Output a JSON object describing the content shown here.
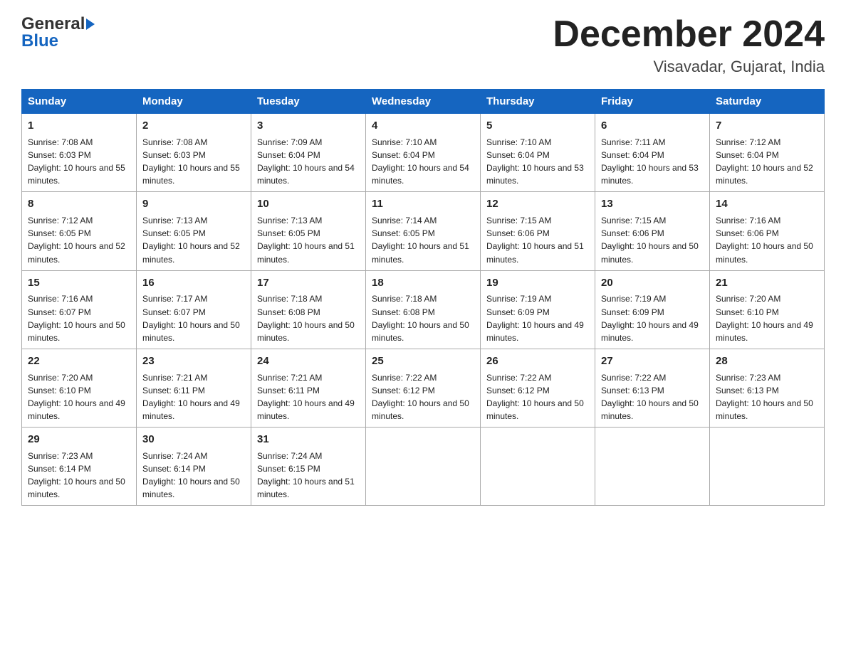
{
  "header": {
    "logo_general": "General",
    "logo_blue": "Blue",
    "month_title": "December 2024",
    "location": "Visavadar, Gujarat, India"
  },
  "days_of_week": [
    "Sunday",
    "Monday",
    "Tuesday",
    "Wednesday",
    "Thursday",
    "Friday",
    "Saturday"
  ],
  "weeks": [
    [
      {
        "day": "1",
        "sunrise": "7:08 AM",
        "sunset": "6:03 PM",
        "daylight": "10 hours and 55 minutes."
      },
      {
        "day": "2",
        "sunrise": "7:08 AM",
        "sunset": "6:03 PM",
        "daylight": "10 hours and 55 minutes."
      },
      {
        "day": "3",
        "sunrise": "7:09 AM",
        "sunset": "6:04 PM",
        "daylight": "10 hours and 54 minutes."
      },
      {
        "day": "4",
        "sunrise": "7:10 AM",
        "sunset": "6:04 PM",
        "daylight": "10 hours and 54 minutes."
      },
      {
        "day": "5",
        "sunrise": "7:10 AM",
        "sunset": "6:04 PM",
        "daylight": "10 hours and 53 minutes."
      },
      {
        "day": "6",
        "sunrise": "7:11 AM",
        "sunset": "6:04 PM",
        "daylight": "10 hours and 53 minutes."
      },
      {
        "day": "7",
        "sunrise": "7:12 AM",
        "sunset": "6:04 PM",
        "daylight": "10 hours and 52 minutes."
      }
    ],
    [
      {
        "day": "8",
        "sunrise": "7:12 AM",
        "sunset": "6:05 PM",
        "daylight": "10 hours and 52 minutes."
      },
      {
        "day": "9",
        "sunrise": "7:13 AM",
        "sunset": "6:05 PM",
        "daylight": "10 hours and 52 minutes."
      },
      {
        "day": "10",
        "sunrise": "7:13 AM",
        "sunset": "6:05 PM",
        "daylight": "10 hours and 51 minutes."
      },
      {
        "day": "11",
        "sunrise": "7:14 AM",
        "sunset": "6:05 PM",
        "daylight": "10 hours and 51 minutes."
      },
      {
        "day": "12",
        "sunrise": "7:15 AM",
        "sunset": "6:06 PM",
        "daylight": "10 hours and 51 minutes."
      },
      {
        "day": "13",
        "sunrise": "7:15 AM",
        "sunset": "6:06 PM",
        "daylight": "10 hours and 50 minutes."
      },
      {
        "day": "14",
        "sunrise": "7:16 AM",
        "sunset": "6:06 PM",
        "daylight": "10 hours and 50 minutes."
      }
    ],
    [
      {
        "day": "15",
        "sunrise": "7:16 AM",
        "sunset": "6:07 PM",
        "daylight": "10 hours and 50 minutes."
      },
      {
        "day": "16",
        "sunrise": "7:17 AM",
        "sunset": "6:07 PM",
        "daylight": "10 hours and 50 minutes."
      },
      {
        "day": "17",
        "sunrise": "7:18 AM",
        "sunset": "6:08 PM",
        "daylight": "10 hours and 50 minutes."
      },
      {
        "day": "18",
        "sunrise": "7:18 AM",
        "sunset": "6:08 PM",
        "daylight": "10 hours and 50 minutes."
      },
      {
        "day": "19",
        "sunrise": "7:19 AM",
        "sunset": "6:09 PM",
        "daylight": "10 hours and 49 minutes."
      },
      {
        "day": "20",
        "sunrise": "7:19 AM",
        "sunset": "6:09 PM",
        "daylight": "10 hours and 49 minutes."
      },
      {
        "day": "21",
        "sunrise": "7:20 AM",
        "sunset": "6:10 PM",
        "daylight": "10 hours and 49 minutes."
      }
    ],
    [
      {
        "day": "22",
        "sunrise": "7:20 AM",
        "sunset": "6:10 PM",
        "daylight": "10 hours and 49 minutes."
      },
      {
        "day": "23",
        "sunrise": "7:21 AM",
        "sunset": "6:11 PM",
        "daylight": "10 hours and 49 minutes."
      },
      {
        "day": "24",
        "sunrise": "7:21 AM",
        "sunset": "6:11 PM",
        "daylight": "10 hours and 49 minutes."
      },
      {
        "day": "25",
        "sunrise": "7:22 AM",
        "sunset": "6:12 PM",
        "daylight": "10 hours and 50 minutes."
      },
      {
        "day": "26",
        "sunrise": "7:22 AM",
        "sunset": "6:12 PM",
        "daylight": "10 hours and 50 minutes."
      },
      {
        "day": "27",
        "sunrise": "7:22 AM",
        "sunset": "6:13 PM",
        "daylight": "10 hours and 50 minutes."
      },
      {
        "day": "28",
        "sunrise": "7:23 AM",
        "sunset": "6:13 PM",
        "daylight": "10 hours and 50 minutes."
      }
    ],
    [
      {
        "day": "29",
        "sunrise": "7:23 AM",
        "sunset": "6:14 PM",
        "daylight": "10 hours and 50 minutes."
      },
      {
        "day": "30",
        "sunrise": "7:24 AM",
        "sunset": "6:14 PM",
        "daylight": "10 hours and 50 minutes."
      },
      {
        "day": "31",
        "sunrise": "7:24 AM",
        "sunset": "6:15 PM",
        "daylight": "10 hours and 51 minutes."
      },
      null,
      null,
      null,
      null
    ]
  ]
}
